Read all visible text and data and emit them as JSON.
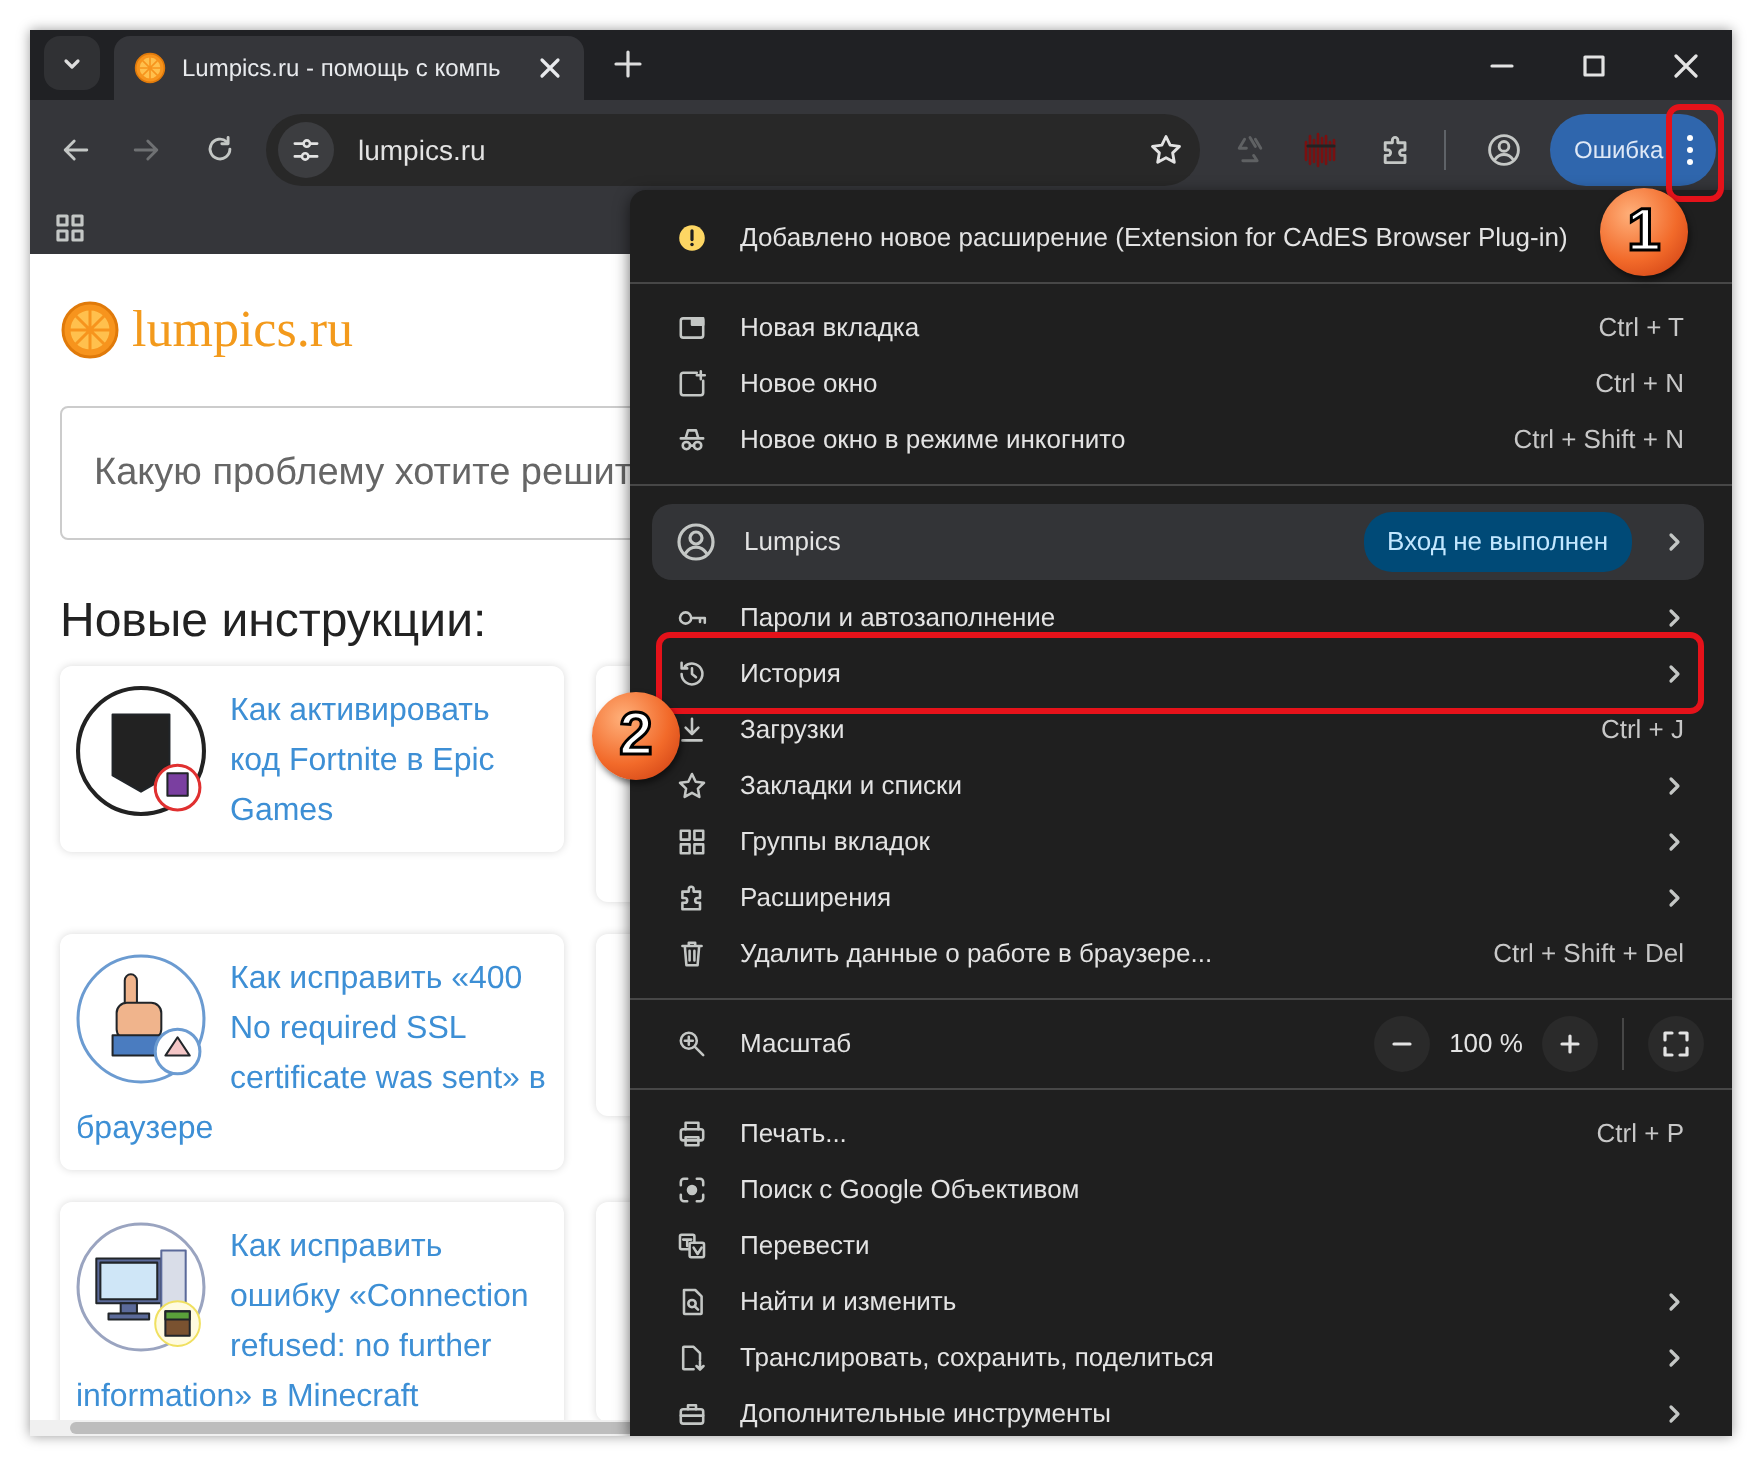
{
  "tab_strip": {
    "tabs": [
      {
        "title": "Lumpics.ru - помощь с компь",
        "selected": true
      }
    ]
  },
  "toolbar": {
    "address": "lumpics.ru",
    "account_button": "Ошибка"
  },
  "page": {
    "logo": "lumpics.ru",
    "search": {
      "placeholder": "Какую проблему хотите решит"
    },
    "heading": "Новые инструкции:",
    "articles": [
      {
        "title": "Как активировать код Fortnite в Epic Games"
      },
      {
        "title": "Как исправить «400 No required SSL certificate was sent» в браузере"
      },
      {
        "title": "Как исправить ошибку «Connection refused: no further information» в Minecraft"
      }
    ]
  },
  "menu": {
    "sections": [
      {
        "rows": [
          {
            "kind": "notice",
            "label": "Добавлено новое расширение (Extension for CAdES Browser Plug-in)"
          }
        ]
      },
      {
        "rows": [
          {
            "kind": "item",
            "label": "Новая вкладка",
            "shortcut": "Ctrl + T",
            "submenu": false
          },
          {
            "kind": "item",
            "label": "Новое окно",
            "shortcut": "Ctrl + N",
            "submenu": false
          },
          {
            "kind": "item",
            "label": "Новое окно в режиме инкогнито",
            "shortcut": "Ctrl + Shift + N",
            "submenu": false
          }
        ]
      },
      {
        "rows": [
          {
            "kind": "profile",
            "label": "Lumpics",
            "status": "Вход не выполнен",
            "submenu": true
          },
          {
            "kind": "item",
            "label": "Пароли и автозаполнение",
            "submenu": true
          },
          {
            "kind": "item",
            "label": "История",
            "submenu": true
          },
          {
            "kind": "item",
            "label": "Загрузки",
            "shortcut": "Ctrl + J",
            "submenu": false
          },
          {
            "kind": "item",
            "label": "Закладки и списки",
            "submenu": true
          },
          {
            "kind": "item",
            "label": "Группы вкладок",
            "submenu": true
          },
          {
            "kind": "item",
            "label": "Расширения",
            "submenu": true
          },
          {
            "kind": "item",
            "label": "Удалить данные о работе в браузере...",
            "shortcut": "Ctrl + Shift + Del",
            "submenu": false
          }
        ]
      },
      {
        "rows": [
          {
            "kind": "zoom",
            "label": "Масштаб",
            "value": "100 %"
          }
        ]
      },
      {
        "rows": [
          {
            "kind": "item",
            "label": "Печать...",
            "shortcut": "Ctrl + P",
            "submenu": false
          },
          {
            "kind": "item",
            "label": "Поиск с Google Объективом",
            "submenu": false
          },
          {
            "kind": "item",
            "label": "Перевести",
            "submenu": false
          },
          {
            "kind": "item",
            "label": "Найти и изменить",
            "submenu": true
          },
          {
            "kind": "item",
            "label": "Транслировать, сохранить, поделиться",
            "submenu": true
          },
          {
            "kind": "item",
            "label": "Дополнительные инструменты",
            "submenu": true
          }
        ]
      }
    ]
  },
  "annotations": [
    {
      "number": "1"
    },
    {
      "number": "2"
    }
  ]
}
